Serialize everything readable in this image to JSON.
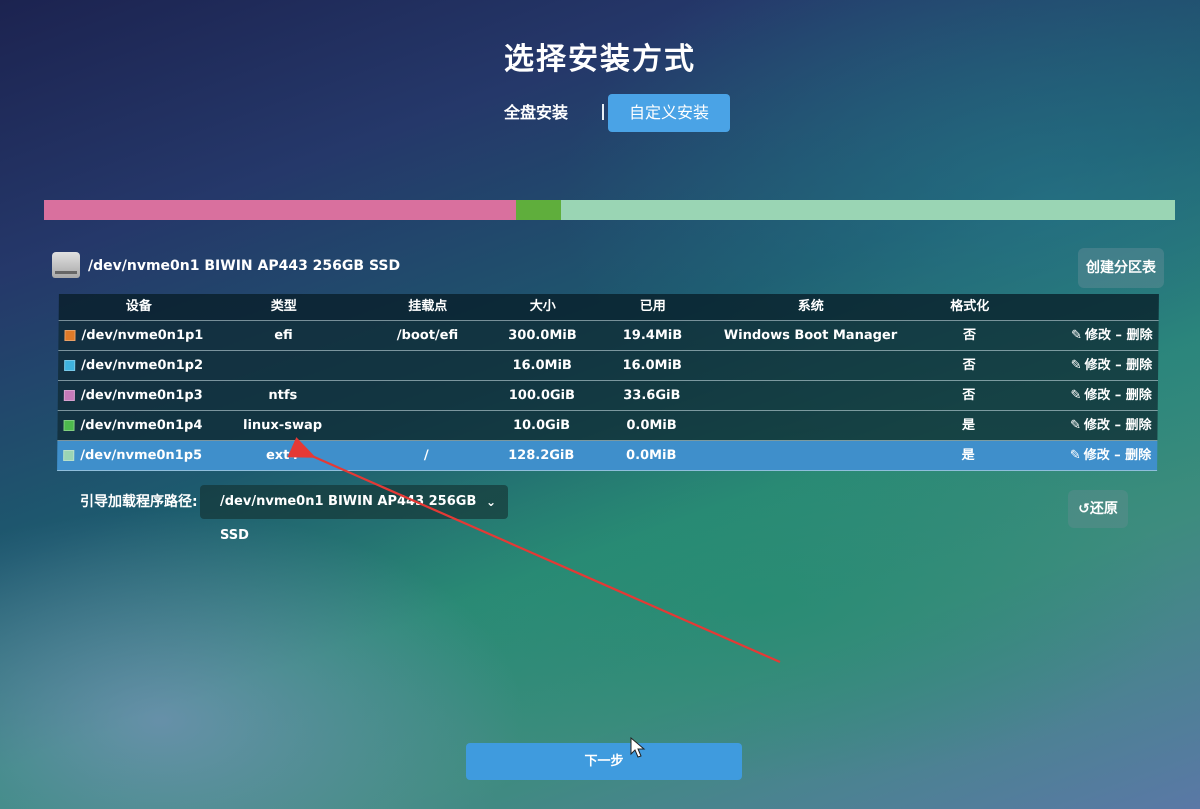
{
  "title": "选择安装方式",
  "mode_tabs": {
    "full": "全盘安装",
    "custom": "自定义安装"
  },
  "disk_bar": {
    "segments": [
      {
        "color": "#d9709e",
        "fraction": 0.417
      },
      {
        "color": "#5fae3c",
        "fraction": 0.04
      },
      {
        "color": "#9ad5b4",
        "fraction": 0.543
      }
    ]
  },
  "disk": {
    "name": "/dev/nvme0n1 BIWIN AP443 256GB SSD",
    "icon": "drive-icon"
  },
  "create_partition_table": "创建分区表",
  "table": {
    "headers": {
      "device": "设备",
      "type": "类型",
      "mount": "挂载点",
      "size": "大小",
      "used": "已用",
      "system": "系统",
      "format": "格式化"
    },
    "rows": [
      {
        "color": "#e07a28",
        "device": "/dev/nvme0n1p1",
        "type": "efi",
        "mount": "/boot/efi",
        "size": "300.0MiB",
        "used": "19.4MiB",
        "system": "Windows Boot Manager",
        "format": "否",
        "selected": false
      },
      {
        "color": "#3fb3e0",
        "device": "/dev/nvme0n1p2",
        "type": "",
        "mount": "",
        "size": "16.0MiB",
        "used": "16.0MiB",
        "system": "",
        "format": "否",
        "selected": false
      },
      {
        "color": "#c67aba",
        "device": "/dev/nvme0n1p3",
        "type": "ntfs",
        "mount": "",
        "size": "100.0GiB",
        "used": "33.6GiB",
        "system": "",
        "format": "否",
        "selected": false
      },
      {
        "color": "#4dba4d",
        "device": "/dev/nvme0n1p4",
        "type": "linux-swap",
        "mount": "",
        "size": "10.0GiB",
        "used": "0.0MiB",
        "system": "",
        "format": "是",
        "selected": false
      },
      {
        "color": "#9ad5b4",
        "device": "/dev/nvme0n1p5",
        "type": "ext4",
        "mount": "/",
        "size": "128.2GiB",
        "used": "0.0MiB",
        "system": "",
        "format": "是",
        "selected": true
      }
    ],
    "actions": {
      "edit": "修改",
      "separator": "–",
      "delete": "删除",
      "edit_icon": "pencil-icon"
    }
  },
  "bootloader": {
    "label": "引导加载程序路径:",
    "value": "/dev/nvme0n1 BIWIN AP443 256GB SSD"
  },
  "restore": {
    "label": "还原",
    "icon": "undo-icon"
  },
  "next": {
    "label": "下一步"
  },
  "colors": {
    "accent": "#4aa3e6",
    "selected_row": "#3f8fcb",
    "annotation_arrow": "#e53935"
  }
}
